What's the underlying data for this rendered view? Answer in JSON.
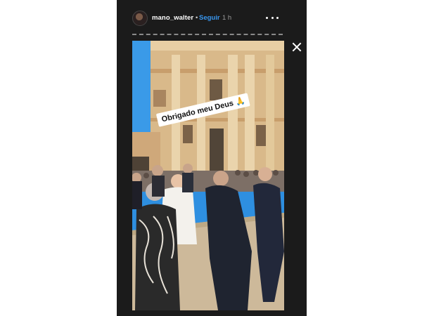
{
  "header": {
    "username": "mano_walter",
    "separator": "•",
    "follow_label": "Seguir",
    "time_ago": "1 h",
    "avatar_icon": "profile-avatar",
    "more_icon": "more-dots-icon"
  },
  "story": {
    "progress_fraction": 1.0,
    "sticker_text": "Obrigado meu Deus 🙏",
    "close_icon": "close-icon"
  },
  "colors": {
    "background": "#1b1b1b",
    "follow": "#3897f0",
    "sticker_bg": "#ffffff"
  }
}
